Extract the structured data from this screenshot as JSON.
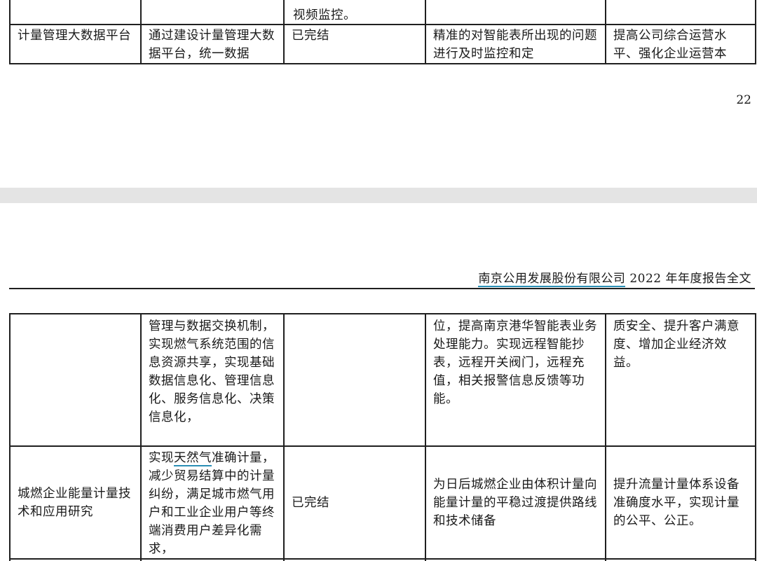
{
  "page_top": {
    "table": {
      "prev_row_fragment": "视频监控。",
      "row": {
        "project": "计量管理大数据平台",
        "purpose": "通过建设计量管理大数据平台，统一数据",
        "progress": "已完结",
        "goal": "精准的对智能表所出现的问题进行及时监控和定",
        "impact": "提高公司综合运营水平、强化企业运营本"
      }
    },
    "page_number": "22"
  },
  "page_bottom": {
    "header": {
      "company": "南京公用发展股份有限公司",
      "report_title": " 2022 年年度报告全文"
    },
    "table": {
      "row1": {
        "purpose": "管理与数据交换机制，实现燃气系统范围的信息资源共享，实现基础数据信息化、管理信息化、服务信息化、决策信息化，",
        "goal": "位，提高南京港华智能表业务处理能力。实现远程智能抄表，远程开关阀门，远程充值，相关报警信息反馈等功能。",
        "impact": "质安全、提升客户满意度、增加企业经济效益。"
      },
      "row2": {
        "project": "城燃企业能量计量技术和应用研究",
        "purpose_pre": "实现",
        "purpose_highlight": "天然气",
        "purpose_post": "准确计量，减少贸易结算中的计量纠纷，满足城市燃气用户和工业企业用户等终端消费用户差异化需求，",
        "progress": "已完结",
        "goal": "为日后城燃企业由体积计量向能量计量的平稳过渡提供路线和技术储备",
        "impact": "提升流量计量体系设备准确度水平，实现计量的公平、公正。"
      }
    }
  }
}
